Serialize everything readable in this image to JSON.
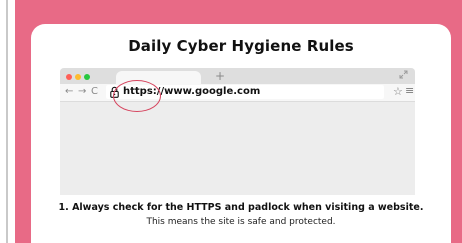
{
  "card": {
    "title": "Daily Cyber Hygiene Rules"
  },
  "browser": {
    "new_tab_symbol": "+",
    "nav": {
      "back": "←",
      "forward": "→",
      "reload": "C"
    },
    "url": "https://www.google.com",
    "star": "☆",
    "menu": "≡"
  },
  "rule": {
    "heading": "1. Always check for the HTTPS and padlock when visiting a website.",
    "subtext": "This means the site is safe and protected."
  },
  "colors": {
    "frame": "#e86a86",
    "highlight": "#d6455f"
  }
}
